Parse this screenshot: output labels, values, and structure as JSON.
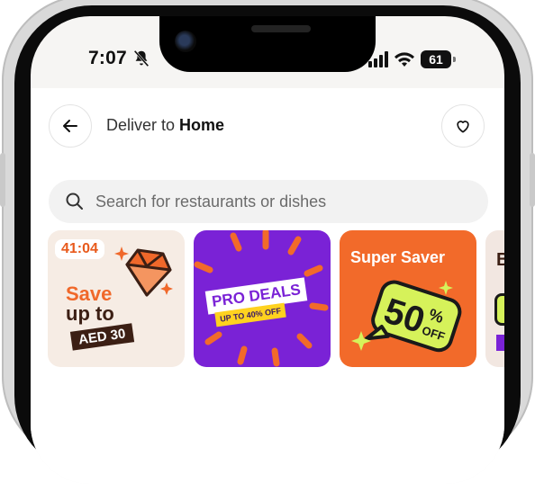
{
  "status_bar": {
    "time": "7:07",
    "battery": "61"
  },
  "header": {
    "deliver_prefix": "Deliver to",
    "location": "Home"
  },
  "search": {
    "placeholder": "Search for restaurants or dishes"
  },
  "promos": [
    {
      "timer": "41:04",
      "line1": "Save",
      "line2": "up to",
      "badge": "AED 30"
    },
    {
      "title": "PRO DEALS",
      "subtitle": "UP TO 40% OFF"
    },
    {
      "title": "Super Saver",
      "percent": "50",
      "percent_sign": "%",
      "off": "OFF"
    },
    {
      "peek_letter": "B"
    }
  ],
  "colors": {
    "orange": "#f26a2a",
    "purple": "#7a22d6",
    "cream": "#f6ece4",
    "dark_brown": "#3c1f14",
    "lime": "#d6f25a"
  },
  "icons": [
    "bell-slash-icon",
    "signal-icon",
    "wifi-icon",
    "back-arrow-icon",
    "heart-icon",
    "search-icon"
  ]
}
